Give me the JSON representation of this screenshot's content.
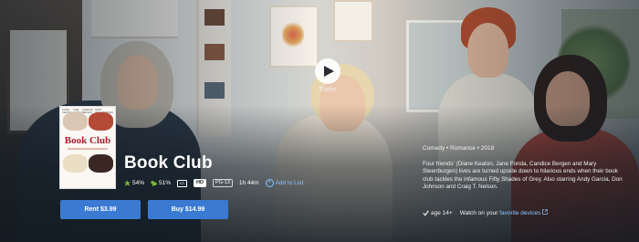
{
  "trailer": {
    "label": "Trailer"
  },
  "movie": {
    "title": "Book Club",
    "poster": {
      "title": "Book Club",
      "cast_names": [
        "DIANE KEATON",
        "JANE FONDA",
        "CANDICE BERGEN",
        "MARY STEENBURGEN"
      ]
    },
    "scores": {
      "critics": "54%",
      "audience": "51%"
    },
    "format": "HD",
    "rating": "PG-13",
    "runtime": "1h 44m",
    "add_to_list": "Add to List"
  },
  "buttons": {
    "rent": "Rent $3.99",
    "buy": "Buy $14.99"
  },
  "info": {
    "genres": "Comedy  •  Romance  •  2018",
    "description": "Four friends' (Diane Keaton, Jane Fonda, Candice Bergen and Mary Steenburgen) lives are turned upside down to hilarious ends when their book club tackles the infamous Fifty Shades of Grey. Also starring Andy Garcia, Don Johnson and Craig T. Nelson.",
    "age": "age 14+",
    "watch_prefix": "Watch on your",
    "watch_link": "favorite devices"
  },
  "colors": {
    "button": "#3a7ad2",
    "link": "#8ac6ff",
    "poster_title": "#b0182d"
  }
}
